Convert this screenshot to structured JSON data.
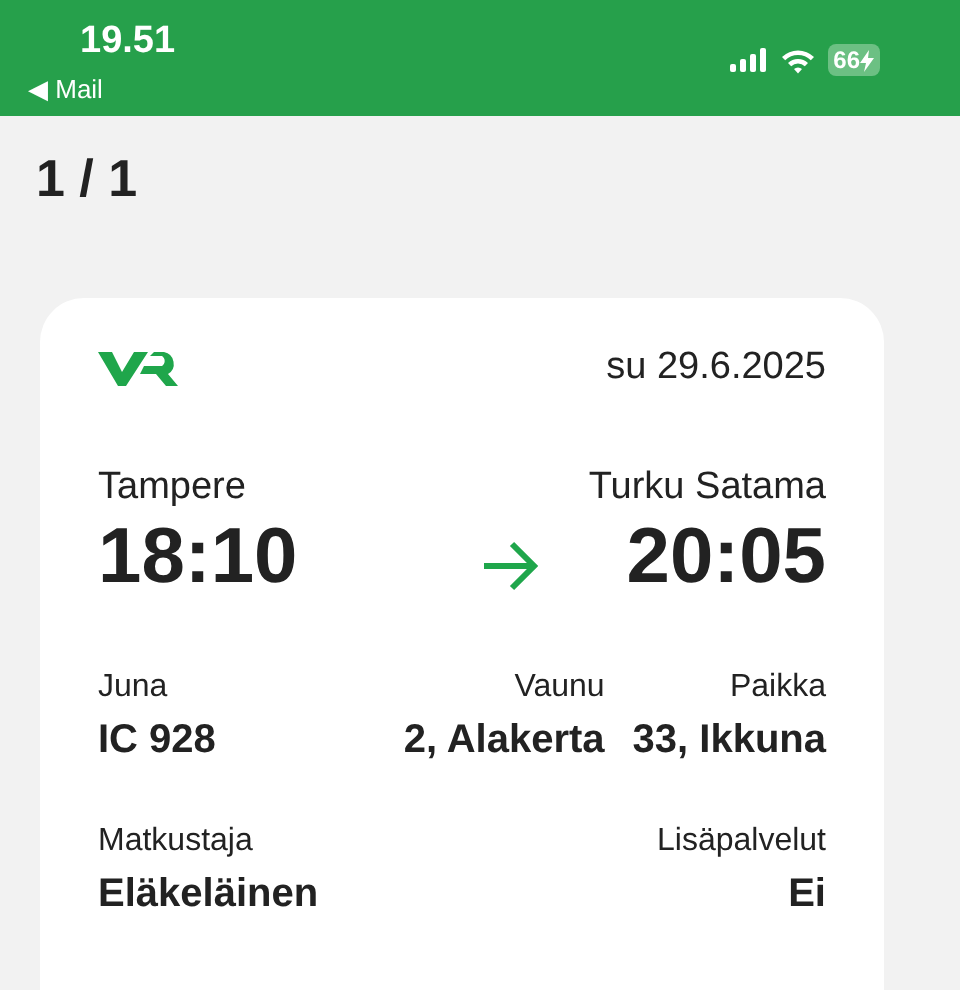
{
  "status_bar": {
    "time": "19.51",
    "back": "◀ Mail",
    "battery": "66"
  },
  "page_counter": "1 / 1",
  "ticket": {
    "date": "su 29.6.2025",
    "from": {
      "station": "Tampere",
      "time": "18:10"
    },
    "to": {
      "station": "Turku Satama",
      "time": "20:05"
    },
    "details": [
      {
        "label": "Juna",
        "value": "IC 928"
      },
      {
        "label": "Vaunu",
        "value": "2, Alakerta"
      },
      {
        "label": "Paikka",
        "value": "33, Ikkuna"
      }
    ],
    "extra": [
      {
        "label": "Matkustaja",
        "value": "Eläkeläinen"
      },
      {
        "label": "Lisäpalvelut",
        "value": "Ei"
      }
    ]
  }
}
